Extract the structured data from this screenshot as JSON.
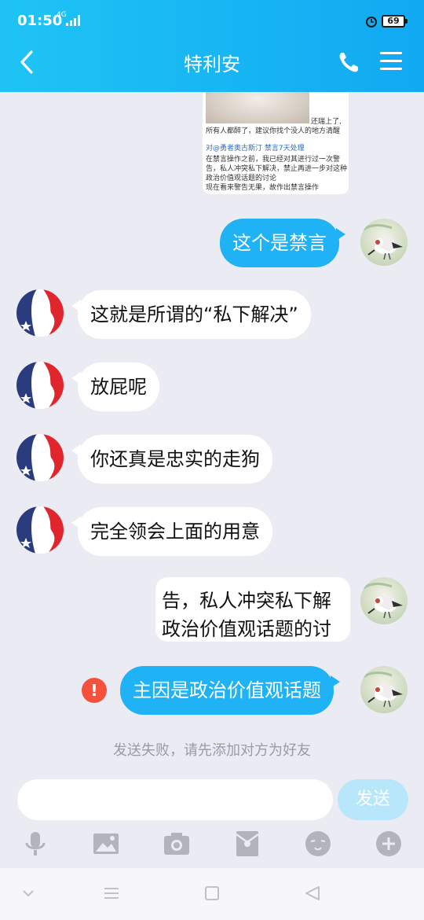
{
  "status_bar": {
    "time": "01:50",
    "network": "4G",
    "battery": "69"
  },
  "header": {
    "title": "特利安"
  },
  "image_message": {
    "caption_top": "还瑞上了,",
    "lines": [
      "所有人都醉了，建议你找个没人的地方清醒",
      "",
      "对@勇者奥古斯汀 禁言7天处理",
      "在禁言操作之前，我已经对其进行过一次警",
      "告，私人冲突私下解决，禁止再进一步对这种",
      "政治价值观话题的讨论",
      "现在看来警告无果，故作出禁言操作"
    ]
  },
  "messages": [
    {
      "side": "out",
      "text": "这个是禁言"
    },
    {
      "side": "in",
      "text": "这就是所谓的“私下解决”"
    },
    {
      "side": "in",
      "text": "放屁呢"
    },
    {
      "side": "in",
      "text": "你还真是忠实的走狗"
    },
    {
      "side": "in",
      "text": "完全领会上面的用意"
    },
    {
      "side": "out",
      "text": "主因是政治价值观话题",
      "failed": true
    }
  ],
  "forwarded": {
    "line1": "告，私人冲突私下解",
    "line2": "政治价值观话题的讨"
  },
  "fail_icon": "!",
  "notice": "发送失败，请先添加对方为好友",
  "composer": {
    "placeholder": "",
    "send_label": "发送"
  },
  "toolbar_icons": [
    "mic-icon",
    "image-icon",
    "camera-icon",
    "red-packet-icon",
    "emoji-icon",
    "plus-icon"
  ],
  "colors": {
    "header": "#12aaf2",
    "out_bubble": "#1fb2f5",
    "fail": "#f4523d"
  }
}
